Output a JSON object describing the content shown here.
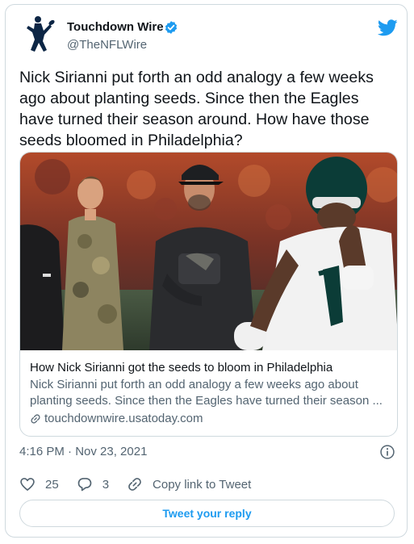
{
  "author": {
    "name": "Touchdown Wire",
    "handle": "@TheNFLWire"
  },
  "tweet": {
    "line1": "Nick Sirianni put forth an odd analogy a few weeks",
    "line2": "ago about planting seeds. Since then the Eagles",
    "line3": "have turned their season around. How have those",
    "line4": "seeds bloomed in Philadelphia?"
  },
  "link_card": {
    "title": "How Nick Sirianni got the seeds to bloom in Philadelphia",
    "description_line1": "Nick Sirianni put forth an odd analogy a few weeks ago about",
    "description_line2": "planting seeds. Since then the Eagles have turned their season ...",
    "domain": "touchdownwire.usatoday.com"
  },
  "meta": {
    "timestamp": "4:16 PM · Nov 23, 2021"
  },
  "actions": {
    "likes": "25",
    "replies": "3",
    "copy_link": "Copy link to Tweet"
  },
  "reply_button": "Tweet your reply",
  "colors": {
    "accent": "#1d9bf0",
    "text": "#0f1419",
    "secondary": "#536471",
    "border": "#cfd9de"
  },
  "icons": [
    "logo-avatar-icon",
    "verified-badge-icon",
    "twitter-bird-icon",
    "link-icon",
    "info-icon",
    "heart-icon",
    "reply-bubble-icon",
    "copy-link-icon"
  ]
}
